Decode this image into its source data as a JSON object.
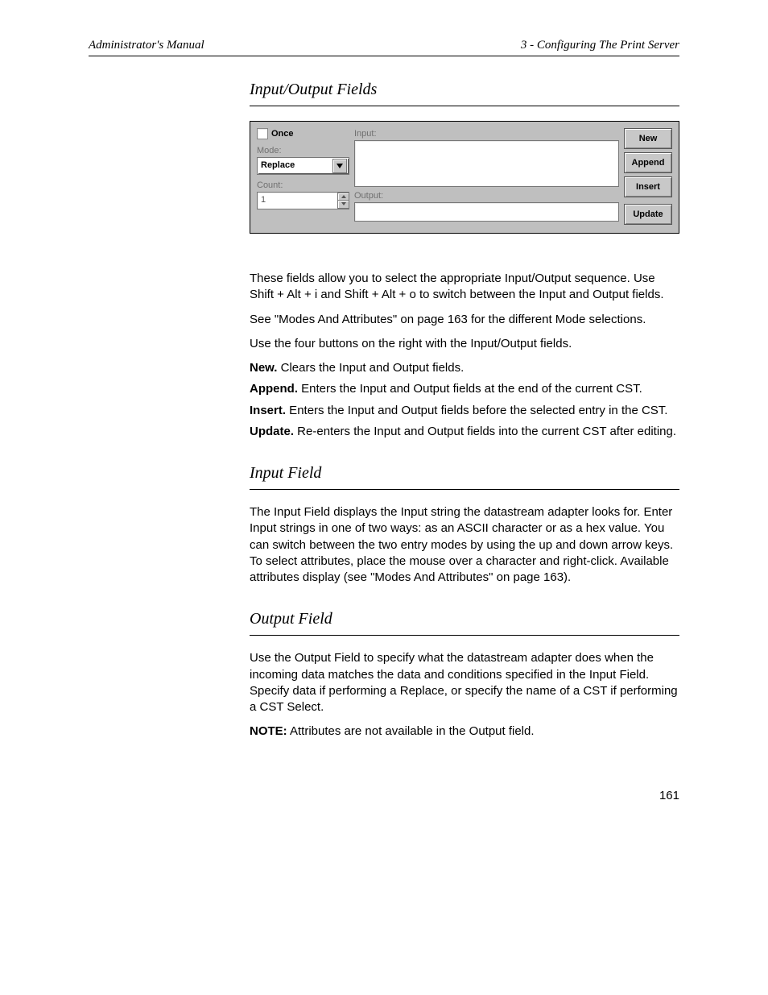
{
  "header": {
    "left": "Administrator's Manual",
    "right": "3 - Configuring The Print Server"
  },
  "sections": {
    "io": {
      "title": "Input/Output Fields"
    },
    "input": {
      "title": "Input Field"
    },
    "output": {
      "title": "Output Field"
    }
  },
  "panel": {
    "once_label": "Once",
    "mode_label": "Mode:",
    "mode_value": "Replace",
    "count_label": "Count:",
    "count_value": "1",
    "input_label": "Input:",
    "output_label": "Output:",
    "buttons": {
      "new": "New",
      "append": "Append",
      "insert": "Insert",
      "update": "Update"
    }
  },
  "body": {
    "p1": "These fields allow you to select the appropriate Input/Output sequence. Use Shift + Alt + i and Shift + Alt + o to switch between the Input and Output fields.",
    "p2": "See \"Modes And Attributes\" on page 163 for the different Mode selections.",
    "p3": "Use the four buttons on the right with the Input/Output fields.",
    "defs": {
      "new": {
        "term": "New.",
        "text": " Clears the Input and Output fields."
      },
      "append": {
        "term": "Append.",
        "text": " Enters the Input and Output fields at the end of the current CST."
      },
      "insert": {
        "term": "Insert.",
        "text": " Enters the Input and Output fields before the selected entry in the CST."
      },
      "update": {
        "term": "Update.",
        "text": " Re-enters the Input and Output fields into the current CST after editing."
      }
    },
    "input_para": "The Input Field displays the Input string the datastream adapter looks for. Enter Input strings in one of two ways: as an ASCII character or as a hex value. You can switch between the two entry modes by using the up and down arrow keys. To select attributes, place the mouse over a character and right-click. Available attributes display (see \"Modes And Attributes\" on page 163).",
    "output_para": "Use the Output Field to specify what the datastream adapter does when the incoming data matches the data and conditions specified in the Input Field. Specify data if performing a Replace, or specify the name of a CST if performing a CST Select.",
    "note": {
      "label": "NOTE:",
      "text": " Attributes are not available in the Output field."
    }
  },
  "page_number": "161"
}
